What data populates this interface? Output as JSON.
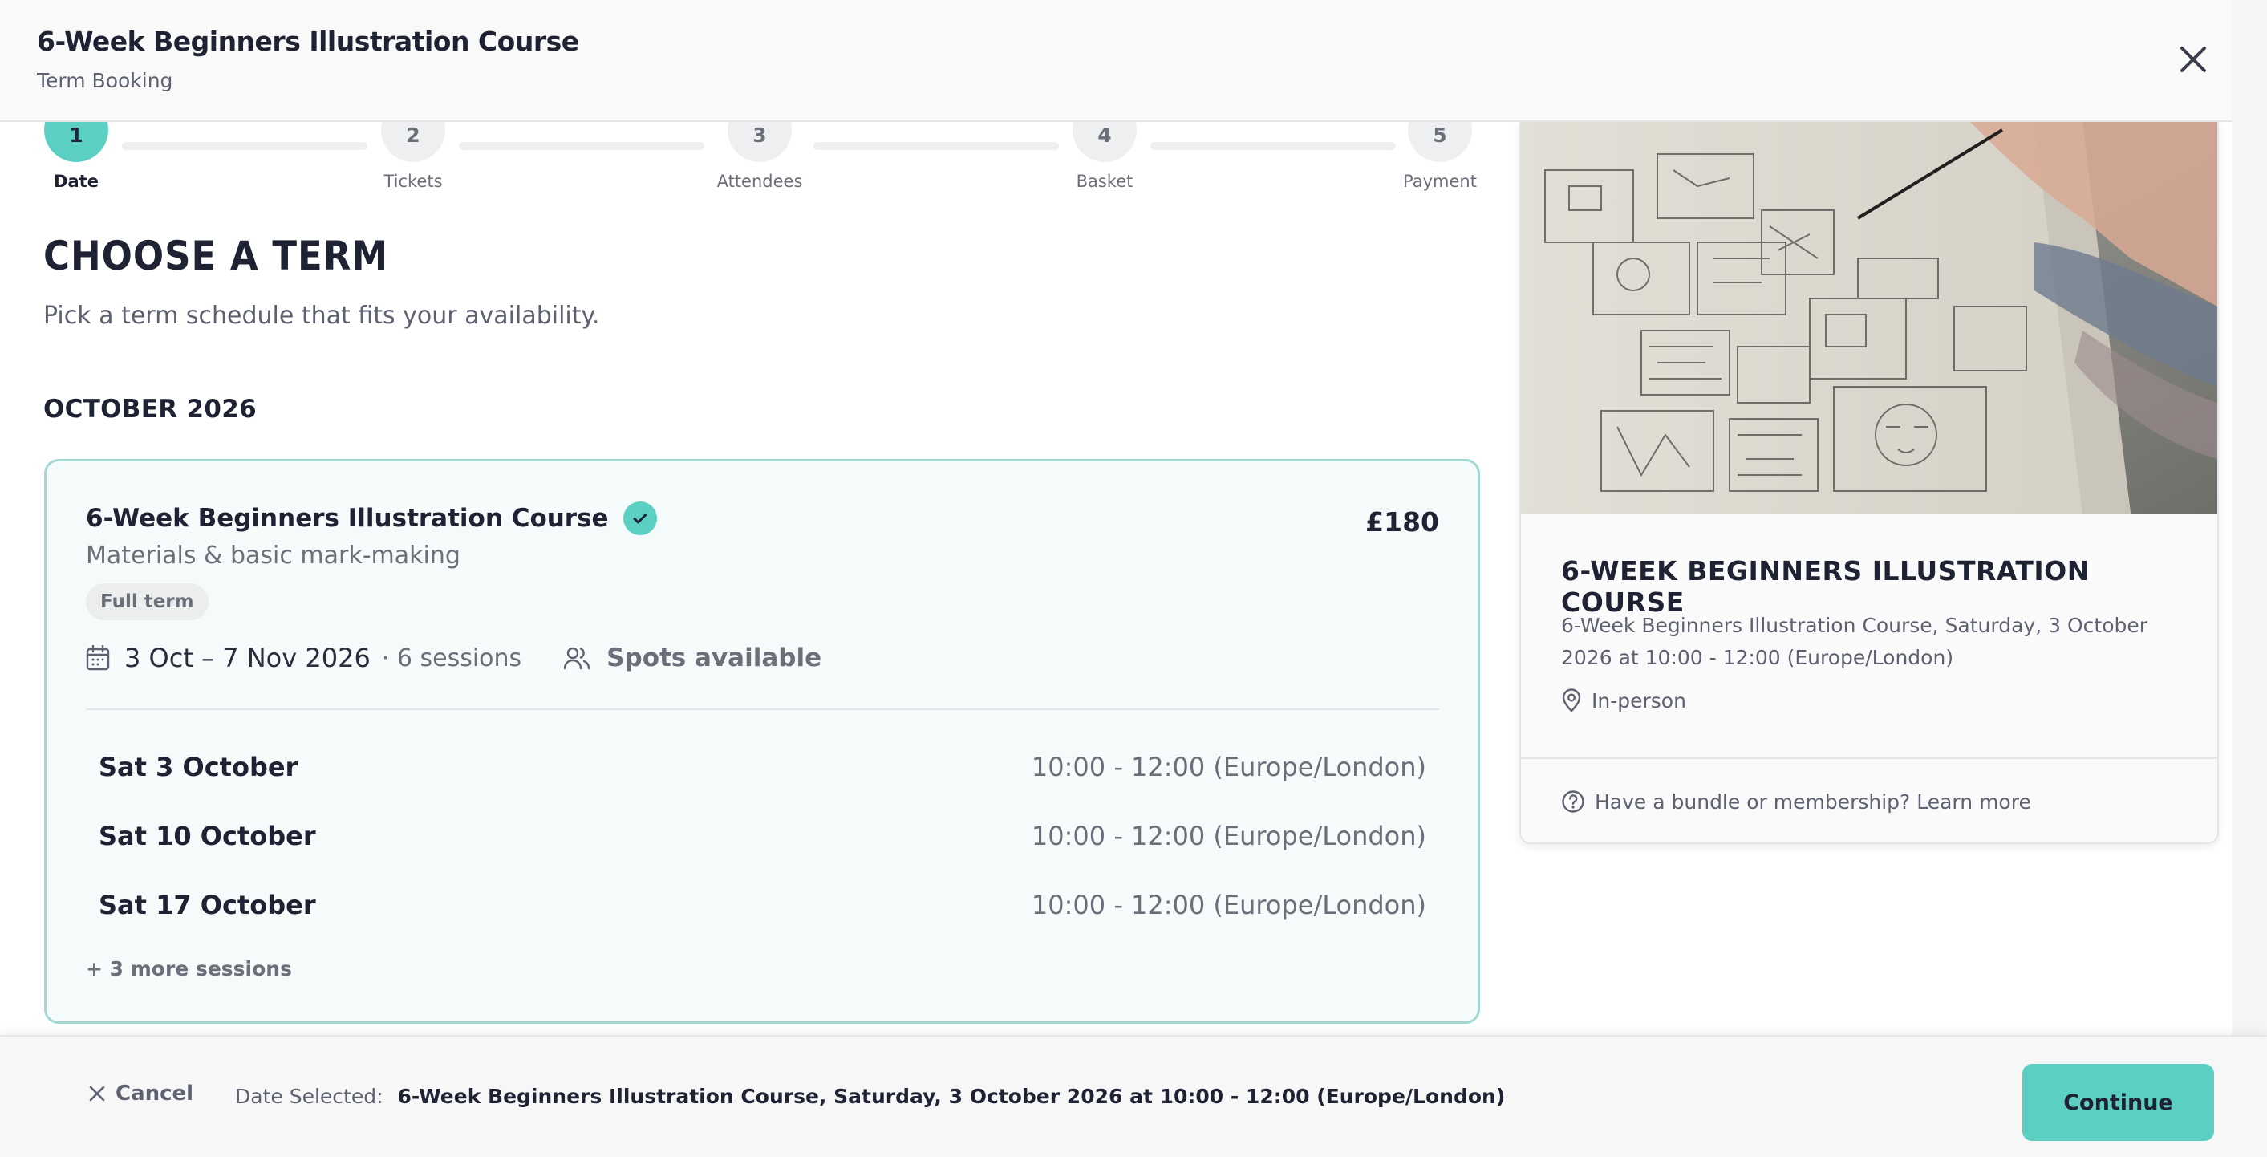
{
  "header": {
    "title": "6-Week Beginners Illustration Course",
    "subtitle": "Term Booking"
  },
  "stepper": {
    "steps": [
      {
        "number": "1",
        "label": "Date",
        "active": true
      },
      {
        "number": "2",
        "label": "Tickets",
        "active": false
      },
      {
        "number": "3",
        "label": "Attendees",
        "active": false
      },
      {
        "number": "4",
        "label": "Basket",
        "active": false
      },
      {
        "number": "5",
        "label": "Payment",
        "active": false
      }
    ]
  },
  "main": {
    "heading": "CHOOSE A TERM",
    "lead": "Pick a term schedule that fits your availability.",
    "month": "OCTOBER 2026",
    "term_card": {
      "title": "6-Week Beginners Illustration Course",
      "subtitle": "Materials & basic mark-making",
      "price": "£180",
      "badge": "Full term",
      "dates": "3 Oct – 7 Nov 2026",
      "sessions_count": "· 6 sessions",
      "availability": "Spots available",
      "sessions": [
        {
          "day": "Sat 3 October",
          "time": "10:00 - 12:00 (Europe/London)"
        },
        {
          "day": "Sat 10 October",
          "time": "10:00 - 12:00 (Europe/London)"
        },
        {
          "day": "Sat 17 October",
          "time": "10:00 - 12:00 (Europe/London)"
        }
      ],
      "more_sessions": "+ 3 more sessions"
    }
  },
  "side": {
    "title": "6-WEEK BEGINNERS ILLUSTRATION COURSE",
    "description": "6-Week Beginners Illustration Course, Saturday, 3 October 2026 at 10:00 - 12:00 (Europe/London)",
    "location": "In-person",
    "help": "Have a bundle or membership? Learn more"
  },
  "footer": {
    "cancel": "Cancel",
    "selected_label": "Date Selected:",
    "selected_value": "6-Week Beginners Illustration Course, Saturday, 3 October 2026 at 10:00 - 12:00 (Europe/London)",
    "continue": "Continue"
  },
  "colors": {
    "accent": "#5ccfc3",
    "card_border": "#a3d7d2",
    "card_bg": "#f5fbfb",
    "text": "#1e2233",
    "muted": "#6c6f7a"
  }
}
